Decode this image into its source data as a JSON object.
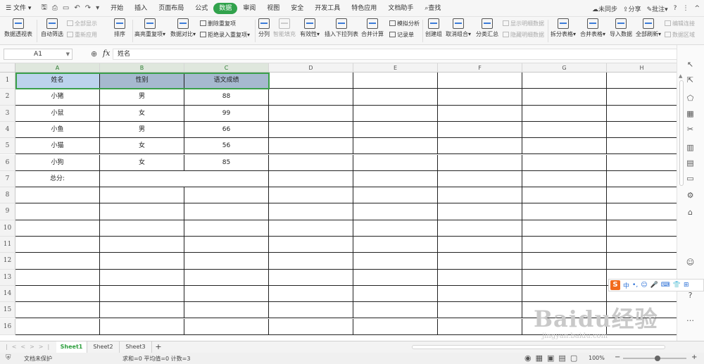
{
  "menubar": {
    "file": "文件",
    "tabs": [
      "开始",
      "插入",
      "页面布局",
      "公式",
      "数据",
      "审阅",
      "视图",
      "安全",
      "开发工具",
      "特色应用",
      "文档助手"
    ],
    "active_tab": "数据",
    "search": "查找",
    "sync": "未同步",
    "share": "分享",
    "comment": "批注"
  },
  "ribbon": {
    "pivot": "数据透视表",
    "autofilter": "自动筛选",
    "show_all": "全部显示",
    "reapply": "重新应用",
    "sort": "排序",
    "highlight_dup": "高亮重复项",
    "compare": "数据对比",
    "remove_dup": "删除重复项",
    "reject_dup": "拒绝录入重复项",
    "split": "分列",
    "smart_fill": "智能填充",
    "validity": "有效性",
    "insert_dropdown": "插入下拉列表",
    "consolidate": "合并计算",
    "simulate": "模拟分析",
    "record": "记录单",
    "create_group": "创建组",
    "ungroup": "取消组合",
    "subtotal": "分类汇总",
    "show_detail": "显示明细数据",
    "hide_detail": "隐藏明细数据",
    "split_table": "拆分表格",
    "merge_table": "合并表格",
    "import": "导入数据",
    "refresh_all": "全部刷新",
    "edit_link": "编辑连接",
    "data_area": "数据区域"
  },
  "formula_bar": {
    "cell_ref": "A1",
    "fx": "fx",
    "content": "姓名"
  },
  "columns": [
    "A",
    "B",
    "C",
    "D",
    "E",
    "F",
    "G",
    "H"
  ],
  "rows": [
    "1",
    "2",
    "3",
    "4",
    "5",
    "6",
    "7",
    "8",
    "9",
    "10",
    "11",
    "12",
    "13",
    "14",
    "15",
    "16"
  ],
  "table": {
    "headers": [
      "姓名",
      "性别",
      "语文成绩"
    ],
    "records": [
      [
        "小猪",
        "男",
        "88"
      ],
      [
        "小鼠",
        "女",
        "99"
      ],
      [
        "小鱼",
        "男",
        "66"
      ],
      [
        "小猫",
        "女",
        "56"
      ],
      [
        "小狗",
        "女",
        "85"
      ]
    ],
    "total_label": "总分:"
  },
  "ime": {
    "logo": "S",
    "lang": "中",
    "punct": "•,"
  },
  "watermark": {
    "brand": "Baidu经验",
    "url": "jingyan.baidu.com"
  },
  "sheets": [
    "Sheet1",
    "Sheet2",
    "Sheet3"
  ],
  "active_sheet": "Sheet1",
  "add_sheet": "+",
  "status": {
    "protection": "文档未保护",
    "calc": "求和=0  平均值=0  计数=3",
    "zoom": "100%"
  },
  "colors": {
    "accent": "#31a24c",
    "header_blue": "#bcd3ec",
    "header_grey": "#a6b9cf"
  }
}
